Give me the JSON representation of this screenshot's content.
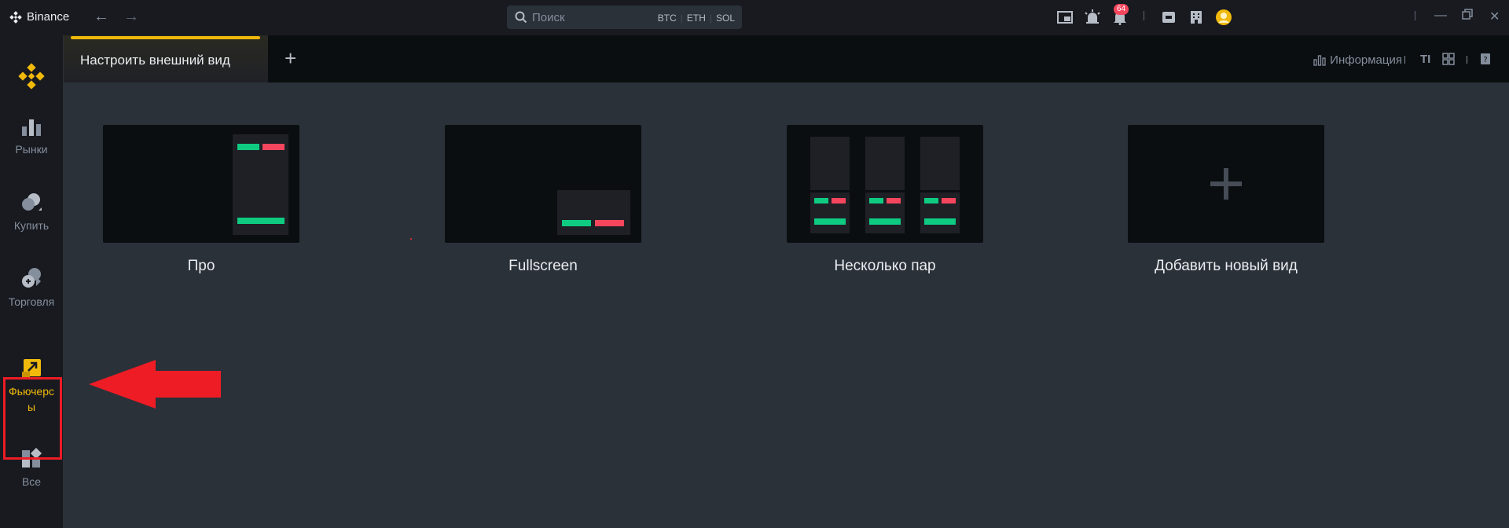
{
  "app": {
    "brand": "Binance",
    "search_placeholder": "Поиск",
    "search_tags": [
      "BTC",
      "ETH",
      "SOL"
    ],
    "notification_count": "64"
  },
  "sidebar": {
    "items": [
      {
        "label": "Рынки",
        "icon": "markets-icon"
      },
      {
        "label": "Купить",
        "icon": "buy-icon"
      },
      {
        "label": "Торговля",
        "icon": "trade-icon"
      },
      {
        "label": "Фьючерсы",
        "icon": "futures-icon",
        "active": true
      },
      {
        "label": "Все",
        "icon": "all-icon"
      }
    ]
  },
  "tabs": {
    "active_label": "Настроить внешний вид",
    "info_label": "Информация"
  },
  "layouts": [
    {
      "label": "Про"
    },
    {
      "label": "Fullscreen"
    },
    {
      "label": "Несколько пар"
    },
    {
      "label": "Добавить новый вид"
    }
  ],
  "colors": {
    "accent": "#f0b90b",
    "buy": "#0ecb81",
    "sell": "#f6465d",
    "annotation": "#ee1c25"
  }
}
